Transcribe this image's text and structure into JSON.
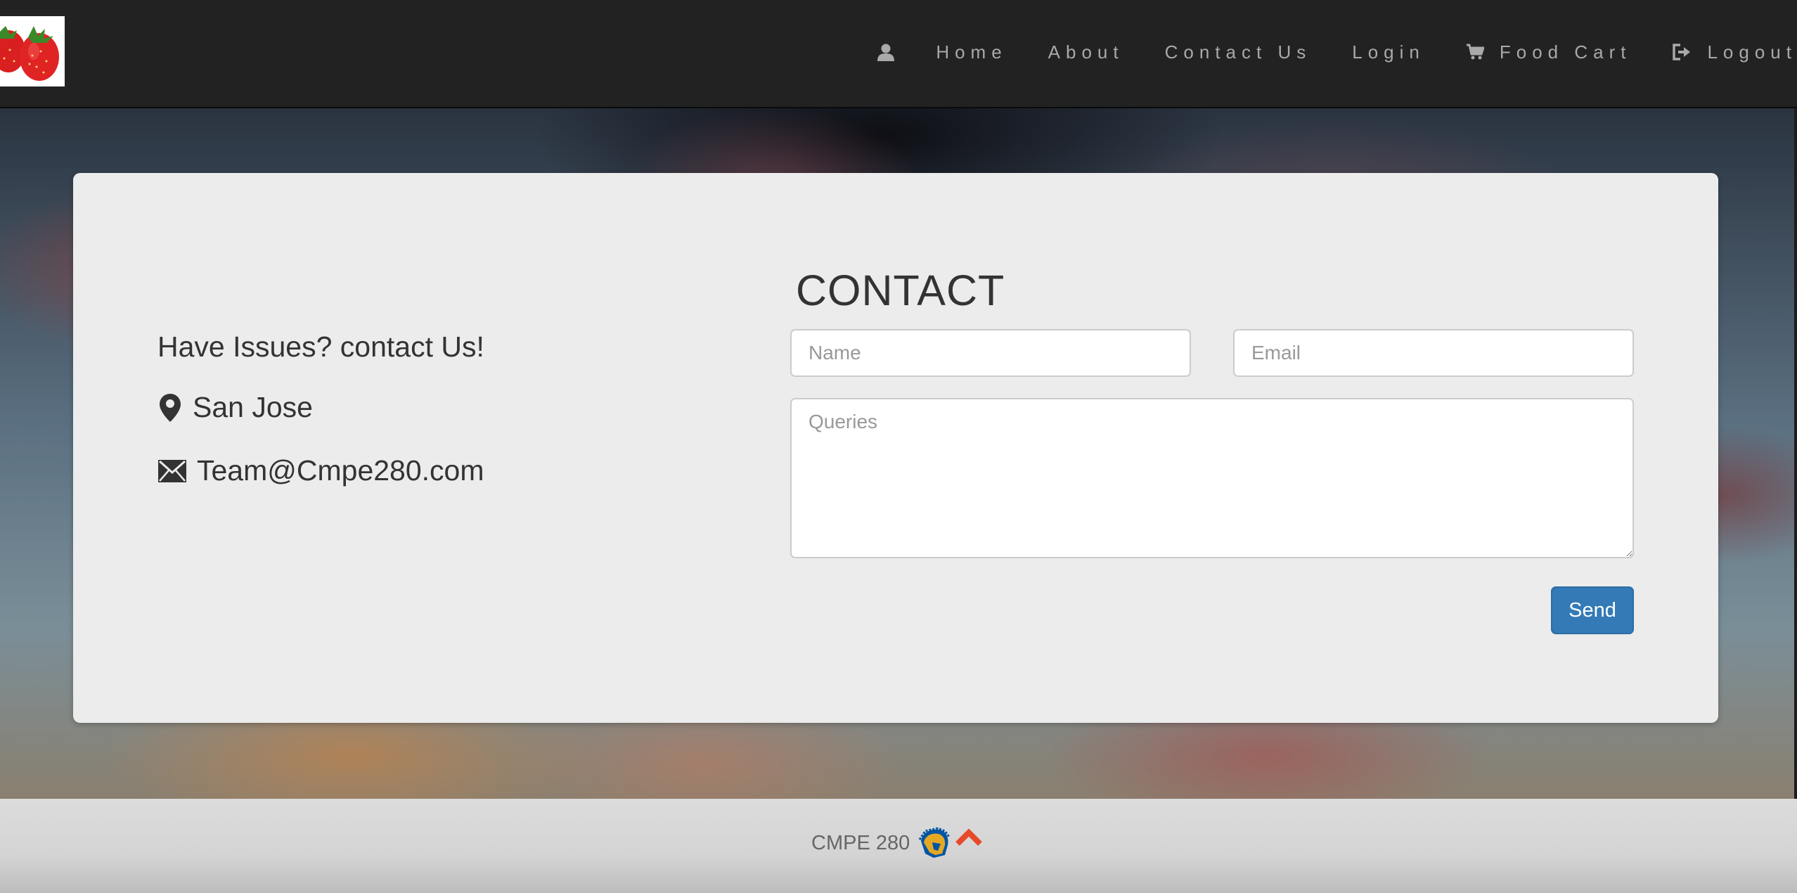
{
  "nav": {
    "logo": "strawberries-logo",
    "items": [
      {
        "label": "",
        "icon": "user-icon"
      },
      {
        "label": "Home",
        "icon": ""
      },
      {
        "label": "About",
        "icon": ""
      },
      {
        "label": "Contact Us",
        "icon": ""
      },
      {
        "label": "Login",
        "icon": ""
      },
      {
        "label": "Food Cart",
        "icon": "cart-icon"
      },
      {
        "label": "Logout",
        "icon": "logout-icon"
      }
    ]
  },
  "info": {
    "heading": "Have Issues? contact Us!",
    "location": "San Jose",
    "location_icon": "map-marker-icon",
    "email": "Team@Cmpe280.com",
    "email_icon": "envelope-icon"
  },
  "form": {
    "title": "CONTACT",
    "name_placeholder": "Name",
    "name_value": "",
    "email_placeholder": "Email",
    "email_value": "",
    "queries_placeholder": "Queries",
    "queries_value": "",
    "send_label": "Send"
  },
  "footer": {
    "text": "CMPE 280",
    "mascot_icon": "spartan-helmet-icon",
    "up_icon": "chevron-up-icon"
  },
  "colors": {
    "navbar": "#222222",
    "panel": "#ececec",
    "send_button": "#337ab7",
    "footer": "#d4d4d4",
    "up_arrow": "#e8492a",
    "spartan_gold": "#e5a823",
    "spartan_blue": "#0055a2"
  }
}
